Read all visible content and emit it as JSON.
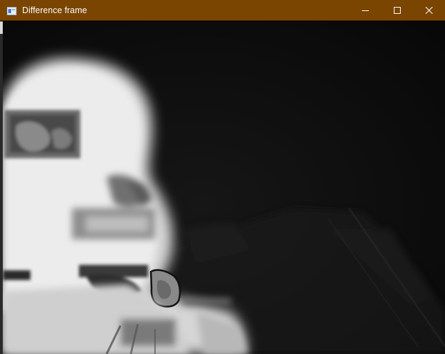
{
  "window": {
    "title": "Difference frame",
    "titlebar_color": "#7a4500",
    "icons": {
      "app": "window-app-icon",
      "minimize": "minimize-icon",
      "maximize": "maximize-icon",
      "close": "close-icon"
    }
  },
  "content": {
    "description_icon": "difference-frame-image"
  }
}
